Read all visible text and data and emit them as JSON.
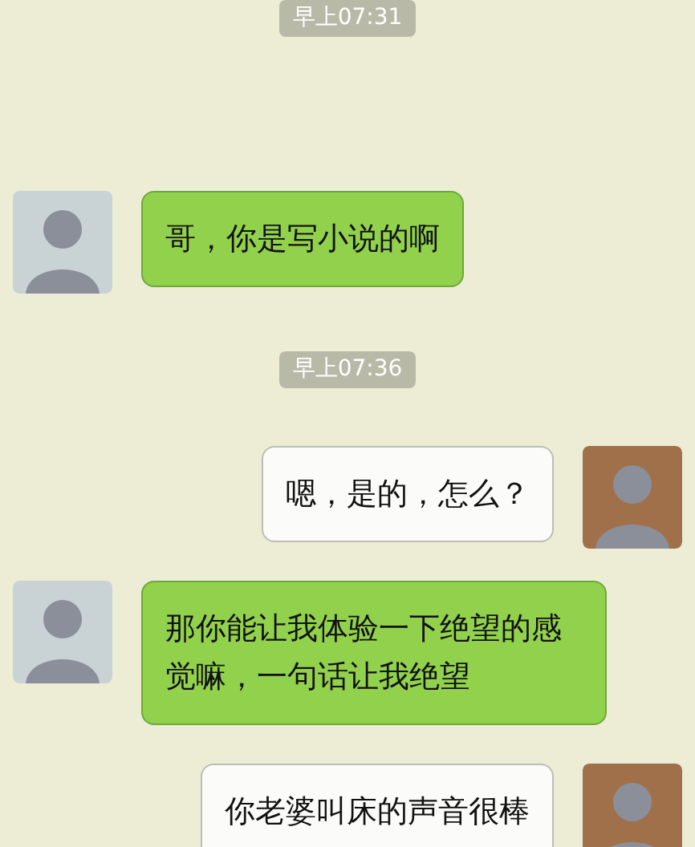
{
  "messages": [
    {
      "kind": "time",
      "text": "早上07:31"
    },
    {
      "kind": "incoming",
      "text": "哥，你是写小说的啊"
    },
    {
      "kind": "time",
      "text": "早上07:36"
    },
    {
      "kind": "outgoing",
      "text": "嗯，是的，怎么？"
    },
    {
      "kind": "incoming",
      "text": "那你能让我体验一下绝望的感觉嘛，一句话让我绝望"
    },
    {
      "kind": "outgoing",
      "text": "你老婆叫床的声音很棒"
    }
  ]
}
